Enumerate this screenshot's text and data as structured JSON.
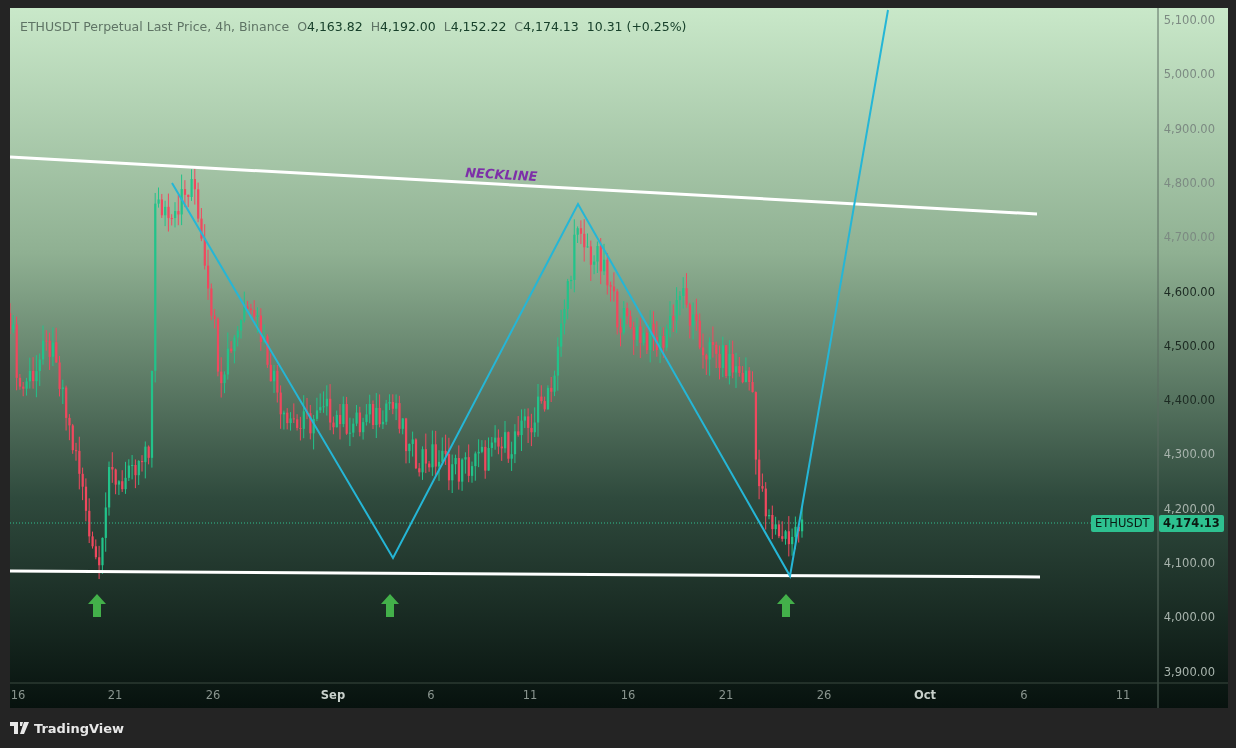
{
  "legend": {
    "title": "ETHUSDT Perpetual Last Price, 4h, Binance",
    "ohlc": [
      {
        "label": "O",
        "value": "4,163.82"
      },
      {
        "label": "H",
        "value": "4,192.00"
      },
      {
        "label": "L",
        "value": "4,152.22"
      },
      {
        "label": "C",
        "value": "4,174.13"
      }
    ],
    "change": "10.31 (+0.25%)"
  },
  "annotation": "NECKLINE",
  "price_axis": [
    "5,100.00",
    "5,000.00",
    "4,900.00",
    "4,800.00",
    "4,700.00",
    "4,600.00",
    "4,500.00",
    "4,400.00",
    "4,300.00",
    "4,200.00",
    "4,100.00",
    "4,000.00",
    "3,900.00"
  ],
  "price_tag": {
    "symbol": "ETHUSDT",
    "price": "4,174.13"
  },
  "time_axis": [
    {
      "label": "16",
      "kind": "day"
    },
    {
      "label": "21",
      "kind": "day"
    },
    {
      "label": "26",
      "kind": "day"
    },
    {
      "label": "Sep",
      "kind": "month"
    },
    {
      "label": "6",
      "kind": "day"
    },
    {
      "label": "11",
      "kind": "day"
    },
    {
      "label": "16",
      "kind": "day"
    },
    {
      "label": "21",
      "kind": "day"
    },
    {
      "label": "26",
      "kind": "day"
    },
    {
      "label": "Oct",
      "kind": "month"
    },
    {
      "label": "6",
      "kind": "day"
    },
    {
      "label": "11",
      "kind": "day"
    }
  ],
  "footer": {
    "brand": "TradingView"
  }
}
